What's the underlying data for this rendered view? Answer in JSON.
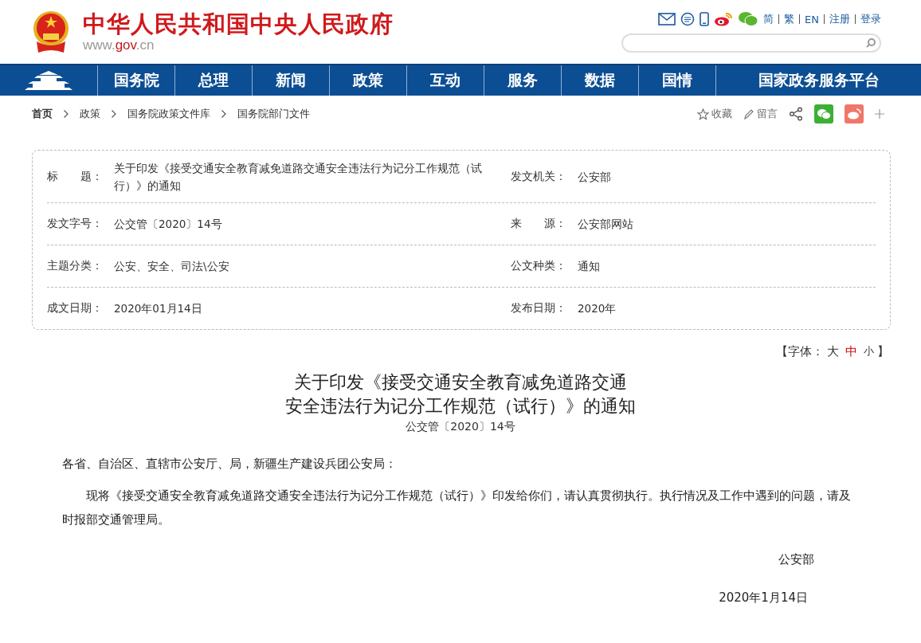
{
  "header": {
    "site_title": "中华人民共和国中央人民政府",
    "domain": {
      "prefix": "www.",
      "highlight": "gov",
      "suffix": ".cn"
    },
    "top_links": [
      {
        "label": "简"
      },
      {
        "label": "繁"
      },
      {
        "label": "EN"
      },
      {
        "label": "注册"
      },
      {
        "label": "登录"
      }
    ]
  },
  "nav": {
    "items": [
      {
        "label": "国务院",
        "selected": false
      },
      {
        "label": "总理",
        "selected": false
      },
      {
        "label": "新闻",
        "selected": false
      },
      {
        "label": "政策",
        "selected": false
      },
      {
        "label": "互动",
        "selected": false
      },
      {
        "label": "服务",
        "selected": false
      },
      {
        "label": "数据",
        "selected": false
      },
      {
        "label": "国情",
        "selected": false
      },
      {
        "label": "国家政务服务平台",
        "selected": false
      }
    ]
  },
  "breadcrumb": [
    {
      "label": "首页"
    },
    {
      "label": "政策"
    },
    {
      "label": "国务院政策文件库"
    },
    {
      "label": "国务院部门文件"
    }
  ],
  "actions": [
    {
      "label": "收藏",
      "kind": "star"
    },
    {
      "label": "留言",
      "kind": "pencil"
    }
  ],
  "info_table": {
    "rows": [
      [
        {
          "label": "标　　题：",
          "value": "关于印发《接受交通安全教育减免道路交通安全违法行为记分工作规范（试行）》的通知"
        },
        {
          "label": "发文机关：",
          "value": "公安部"
        }
      ],
      [
        {
          "label": "发文字号：",
          "value": "公交管〔2020〕14号"
        },
        {
          "label": "来　　源：",
          "value": "公安部网站"
        }
      ],
      [
        {
          "label": "主题分类：",
          "value": "公安、安全、司法\\公安"
        },
        {
          "label": "公文种类：",
          "value": "通知"
        }
      ],
      [
        {
          "label": "成文日期：",
          "value": "2020年01月14日"
        },
        {
          "label": "发布日期：",
          "value": "2020年"
        }
      ]
    ]
  },
  "font_size": {
    "open": "【",
    "label": "字体：",
    "sizes": [
      {
        "label": "大",
        "selected": false
      },
      {
        "label": "中",
        "selected": true
      },
      {
        "label": "小",
        "selected": false
      }
    ],
    "close": "】"
  },
  "article": {
    "title_lines": [
      "关于印发《接受交通安全教育减免道路交通",
      "安全违法行为记分工作规范（试行）》的通知"
    ],
    "doc_number": "公交管〔2020〕14号",
    "salutation": "各省、自治区、直辖市公安厅、局，新疆生产建设兵团公安局：",
    "paragraphs": [
      "现将《接受交通安全教育减免道路交通安全违法行为记分工作规范（试行）》印发给你们，请认真贯彻执行。执行情况及工作中遇到的问题，请及时报部交通管理局。"
    ],
    "signature": "公安部",
    "date": "2020年1月14日"
  }
}
